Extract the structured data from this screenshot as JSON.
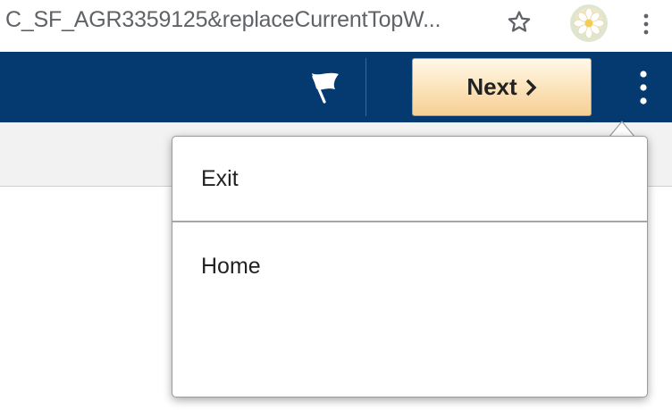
{
  "browser": {
    "url": "C_SF_AGR3359125&replaceCurrentTopW...",
    "icons": [
      "star-icon",
      "avatar",
      "kebab-menu-icon"
    ]
  },
  "header": {
    "background": "#053a70",
    "next_label": "Next",
    "icons": [
      "flag-icon",
      "chevron-right-icon",
      "actions-menu-icon"
    ]
  },
  "menu": {
    "items": [
      {
        "label": "Exit"
      },
      {
        "label": "Home"
      }
    ]
  }
}
